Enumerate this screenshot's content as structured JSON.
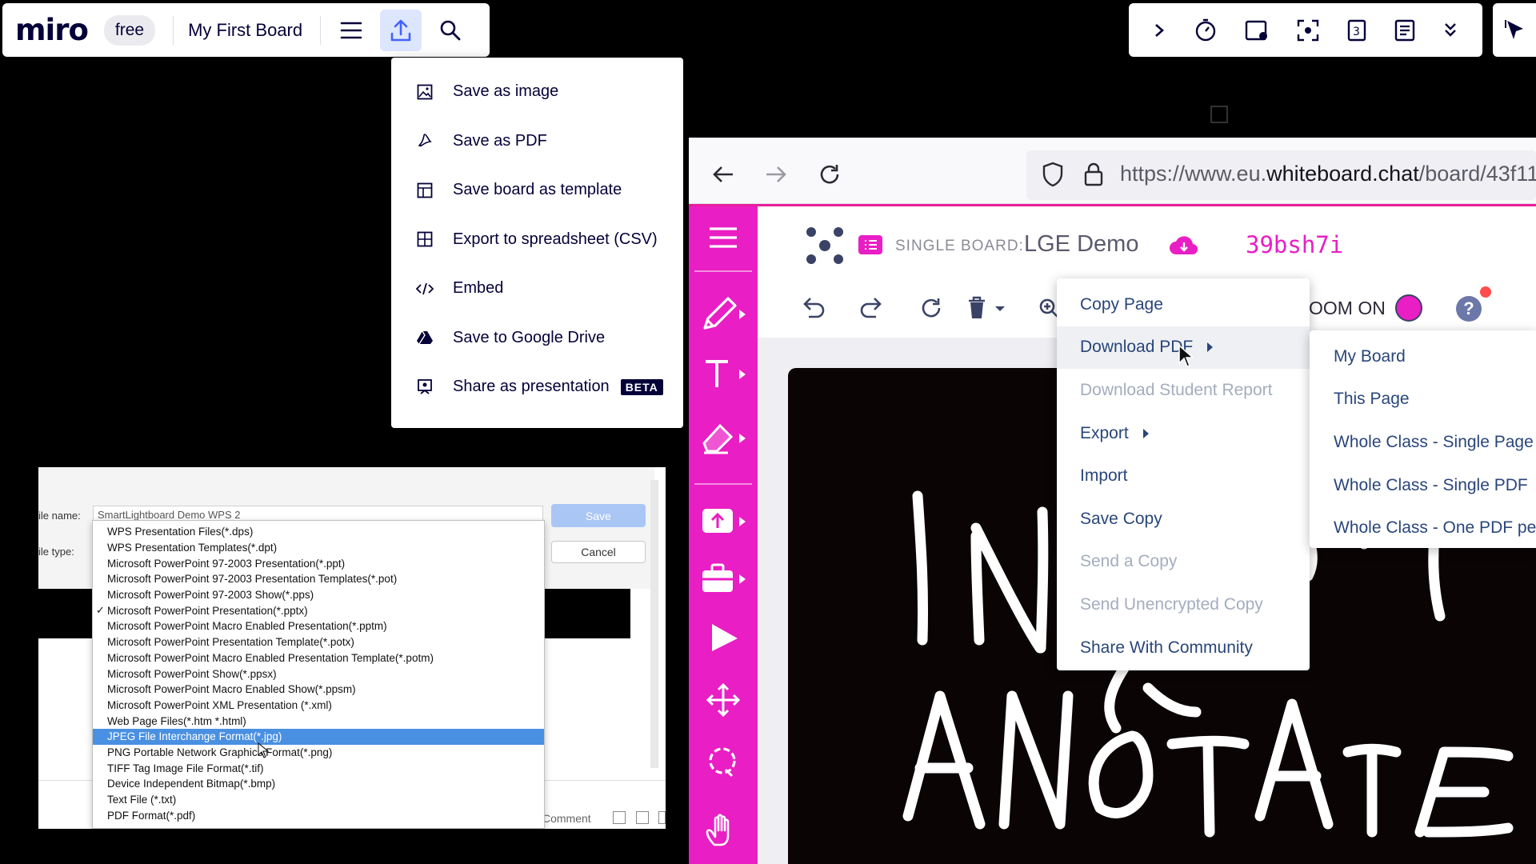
{
  "miro": {
    "logo": "miro",
    "plan": "free",
    "board_name": "My First Board",
    "export_menu": [
      {
        "label": "Save as image",
        "icon": "image-icon"
      },
      {
        "label": "Save as PDF",
        "icon": "pdf-icon"
      },
      {
        "label": "Save board as template",
        "icon": "template-icon"
      },
      {
        "label": "Export to spreadsheet (CSV)",
        "icon": "spreadsheet-icon"
      },
      {
        "label": "Embed",
        "icon": "embed-code-icon"
      },
      {
        "label": "Save to Google Drive",
        "icon": "google-drive-icon"
      },
      {
        "label": "Share as presentation",
        "icon": "presentation-icon",
        "badge": "BETA"
      }
    ]
  },
  "save_dialog": {
    "name_label": "ile name:",
    "type_label": "ile type:",
    "filename": "SmartLightboard Demo WPS 2",
    "save_label": "Save",
    "cancel_label": "Cancel",
    "comment_label": "Comment",
    "checked_item": "Microsoft PowerPoint Presentation(*.pptx)",
    "highlighted_item": "JPEG File Interchange Format(*.jpg)",
    "file_types": [
      "WPS Presentation Files(*.dps)",
      "WPS Presentation Templates(*.dpt)",
      "Microsoft PowerPoint 97-2003 Presentation(*.ppt)",
      "Microsoft PowerPoint 97-2003 Presentation Templates(*.pot)",
      "Microsoft PowerPoint 97-2003 Show(*.pps)",
      "Microsoft PowerPoint Presentation(*.pptx)",
      "Microsoft PowerPoint Macro Enabled Presentation(*.pptm)",
      "Microsoft PowerPoint Presentation Template(*.potx)",
      "Microsoft PowerPoint Macro Enabled Presentation Template(*.potm)",
      "Microsoft PowerPoint Show(*.ppsx)",
      "Microsoft PowerPoint Macro Enabled Show(*.ppsm)",
      "Microsoft PowerPoint XML Presentation (*.xml)",
      "Web Page Files(*.htm *.html)",
      "JPEG File Interchange Format(*.jpg)",
      "PNG Portable Network Graphics Format(*.png)",
      "TIFF Tag Image File Format(*.tif)",
      "Device Independent Bitmap(*.bmp)",
      "Text File (*.txt)",
      "PDF Format(*.pdf)"
    ]
  },
  "whiteboard": {
    "url_prefix": "https://www.eu.",
    "url_domain": "whiteboard.chat",
    "url_path": "/board/43f11",
    "board_label": "SINGLE BOARD:",
    "board_name": "LGE Demo",
    "board_code": "39bsh7i",
    "zoom_text": "OOM ON",
    "accent_color": "#e91ec4",
    "menu": [
      {
        "label": "Copy Page",
        "state": "enabled"
      },
      {
        "label": "Download PDF",
        "state": "hover",
        "submenu": true
      },
      {
        "label": "Download Student Report",
        "state": "disabled"
      },
      {
        "label": "Export",
        "state": "enabled",
        "submenu": true
      },
      {
        "label": "Import",
        "state": "enabled"
      },
      {
        "label": "Save Copy",
        "state": "enabled"
      },
      {
        "label": "Send a Copy",
        "state": "disabled"
      },
      {
        "label": "Send Unencrypted Copy",
        "state": "disabled"
      },
      {
        "label": "Share With Community",
        "state": "enabled"
      }
    ],
    "pdf_submenu": [
      "My Board",
      "This Page",
      "Whole Class - Single Page",
      "Whole Class - Single PDF",
      "Whole Class - One PDF pe"
    ]
  }
}
